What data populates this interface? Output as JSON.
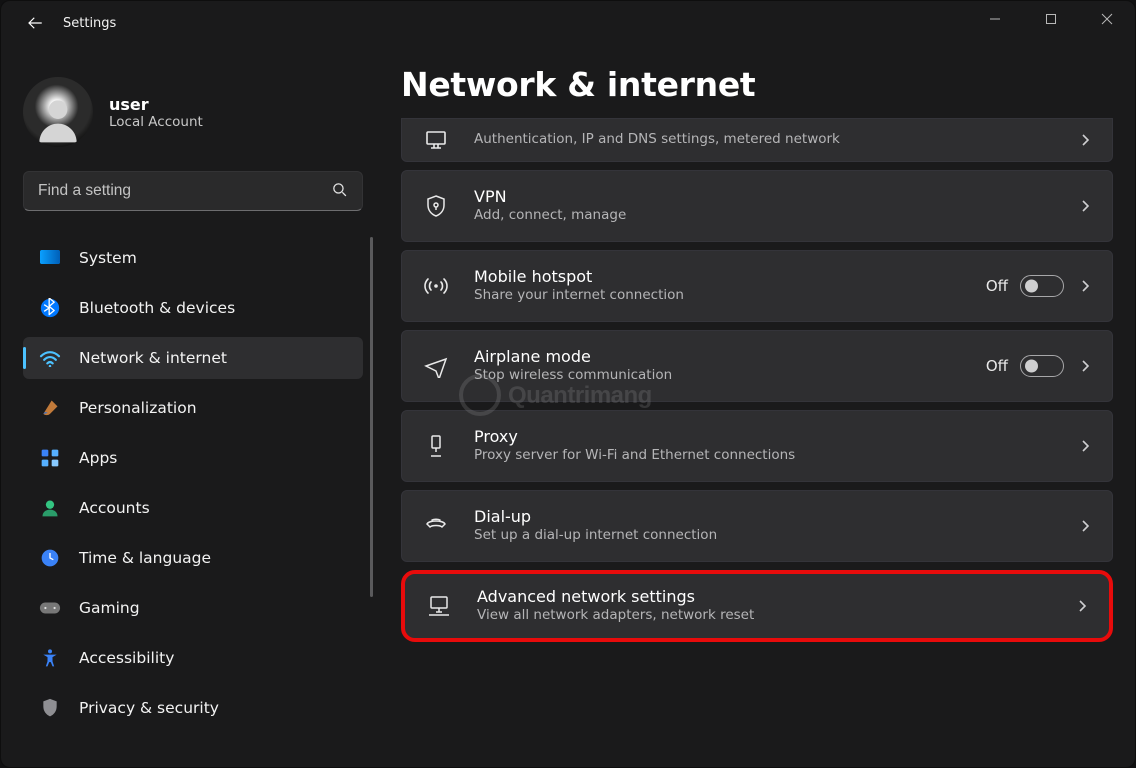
{
  "app": {
    "title": "Settings"
  },
  "profile": {
    "name": "user",
    "sub": "Local Account"
  },
  "search": {
    "placeholder": "Find a setting"
  },
  "nav": {
    "items": [
      {
        "label": "System"
      },
      {
        "label": "Bluetooth & devices"
      },
      {
        "label": "Network & internet"
      },
      {
        "label": "Personalization"
      },
      {
        "label": "Apps"
      },
      {
        "label": "Accounts"
      },
      {
        "label": "Time & language"
      },
      {
        "label": "Gaming"
      },
      {
        "label": "Accessibility"
      },
      {
        "label": "Privacy & security"
      }
    ],
    "active_index": 2
  },
  "page": {
    "title": "Network & internet",
    "rows": [
      {
        "title": "",
        "sub": "Authentication, IP and DNS settings, metered network"
      },
      {
        "title": "VPN",
        "sub": "Add, connect, manage"
      },
      {
        "title": "Mobile hotspot",
        "sub": "Share your internet connection",
        "state": "Off"
      },
      {
        "title": "Airplane mode",
        "sub": "Stop wireless communication",
        "state": "Off"
      },
      {
        "title": "Proxy",
        "sub": "Proxy server for Wi-Fi and Ethernet connections"
      },
      {
        "title": "Dial-up",
        "sub": "Set up a dial-up internet connection"
      },
      {
        "title": "Advanced network settings",
        "sub": "View all network adapters, network reset"
      }
    ]
  },
  "watermark": "Quantrimang"
}
